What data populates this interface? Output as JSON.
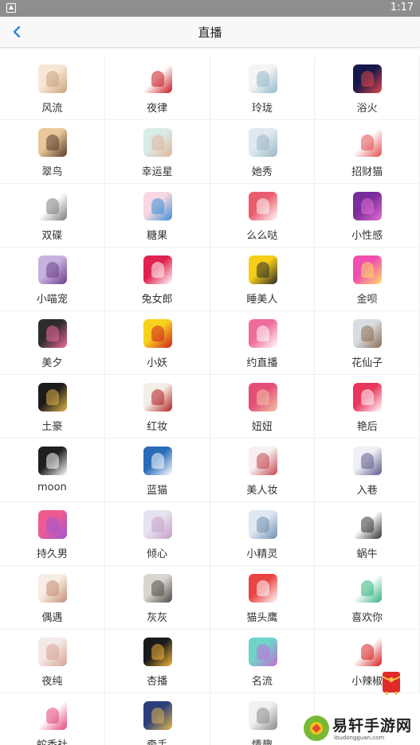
{
  "status_bar": {
    "time": "1:17"
  },
  "nav": {
    "title": "直播"
  },
  "apps": [
    {
      "label": "风流",
      "icon": "anime-girl-icon",
      "c1": "#f6e7d5",
      "c2": "#c9a37b"
    },
    {
      "label": "夜律",
      "icon": "red-calligraphy-icon",
      "c1": "#ffffff",
      "c2": "#c8161d"
    },
    {
      "label": "玲珑",
      "icon": "dancer-icon",
      "c1": "#f4f4f4",
      "c2": "#8fb9c9"
    },
    {
      "label": "浴火",
      "icon": "phoenix-icon",
      "c1": "#16184a",
      "c2": "#e2474b"
    },
    {
      "label": "翠鸟",
      "icon": "girl-photo-icon",
      "c1": "#e9c79a",
      "c2": "#5a3a2a"
    },
    {
      "label": "幸运星",
      "icon": "girl-photo-icon",
      "c1": "#d8ece8",
      "c2": "#e2b59a"
    },
    {
      "label": "她秀",
      "icon": "anime-girl-icon",
      "c1": "#dfe9ef",
      "c2": "#9cb7c6"
    },
    {
      "label": "招财猫",
      "icon": "lucky-cat-icon",
      "c1": "#ffffff",
      "c2": "#e34c4c"
    },
    {
      "label": "双碟",
      "icon": "apple-icon",
      "c1": "#ffffff",
      "c2": "#7b7b7b"
    },
    {
      "label": "糖果",
      "icon": "candy-icon",
      "c1": "#f8d8e2",
      "c2": "#3b8fd8"
    },
    {
      "label": "么么哒",
      "icon": "flower-icon",
      "c1": "#ea5d6f",
      "c2": "#ffffff"
    },
    {
      "label": "小性感",
      "icon": "silhouette-icon",
      "c1": "#7a2d9c",
      "c2": "#e56fd4"
    },
    {
      "label": "小喵宠",
      "icon": "anime-girl-icon",
      "c1": "#c7b2de",
      "c2": "#6b3e8b"
    },
    {
      "label": "兔女郎",
      "icon": "bunny-icon",
      "c1": "#e0234e",
      "c2": "#ffffff"
    },
    {
      "label": "睡美人",
      "icon": "play-icon",
      "c1": "#f6cd17",
      "c2": "#2b2b2b"
    },
    {
      "label": "金呗",
      "icon": "cup-icon",
      "c1": "#f04fae",
      "c2": "#ffe066"
    },
    {
      "label": "美夕",
      "icon": "m-logo-icon",
      "c1": "#2d2d2d",
      "c2": "#f06a9c"
    },
    {
      "label": "小妖",
      "icon": "cartoon-face-icon",
      "c1": "#f7d21d",
      "c2": "#d21f1f"
    },
    {
      "label": "约直播",
      "icon": "yue-logo-icon",
      "c1": "#ee6b9b",
      "c2": "#ffffff"
    },
    {
      "label": "花仙子",
      "icon": "doll-icon",
      "c1": "#d7dde2",
      "c2": "#8b6b52"
    },
    {
      "label": "土豪",
      "icon": "tuhao-logo-icon",
      "c1": "#1b1b1b",
      "c2": "#e2b54b"
    },
    {
      "label": "红妆",
      "icon": "rose-icon",
      "c1": "#f3efe6",
      "c2": "#b21e22"
    },
    {
      "label": "妞妞",
      "icon": "anime-girl-icon",
      "c1": "#e24e78",
      "c2": "#f2c6a6"
    },
    {
      "label": "艳后",
      "icon": "lightning-icon",
      "c1": "#e8365d",
      "c2": "#ffffff"
    },
    {
      "label": "moon",
      "icon": "moon-icon",
      "c1": "#1f1f1f",
      "c2": "#ffffff"
    },
    {
      "label": "蓝猫",
      "icon": "blue-cat-icon",
      "c1": "#2a6bb8",
      "c2": "#ffffff"
    },
    {
      "label": "美人妆",
      "icon": "makeup-icon",
      "c1": "#f7f0f2",
      "c2": "#c2464f"
    },
    {
      "label": "入巷",
      "icon": "anime-girl-icon",
      "c1": "#efeff5",
      "c2": "#5b5b8c"
    },
    {
      "label": "持久男",
      "icon": "heart-icon",
      "c1": "#ee5a8f",
      "c2": "#9d57d8"
    },
    {
      "label": "倾心",
      "icon": "girl-photo-icon",
      "c1": "#e6e2ef",
      "c2": "#c7a0c8"
    },
    {
      "label": "小精灵",
      "icon": "girl-photo-icon",
      "c1": "#dfe8f1",
      "c2": "#6f8fb1"
    },
    {
      "label": "蜗牛",
      "icon": "snail-logo-icon",
      "c1": "#ffffff",
      "c2": "#333333"
    },
    {
      "label": "偶遇",
      "icon": "dancer-icon",
      "c1": "#f7ede6",
      "c2": "#c48e73"
    },
    {
      "label": "灰灰",
      "icon": "girl-photo-icon",
      "c1": "#d9d6cf",
      "c2": "#4f4a45"
    },
    {
      "label": "猫头鹰",
      "icon": "owl-icon",
      "c1": "#e84444",
      "c2": "#ffffff"
    },
    {
      "label": "喜欢你",
      "icon": "cards-icon",
      "c1": "#ffffff",
      "c2": "#35b37e"
    },
    {
      "label": "夜纯",
      "icon": "girl-photo-icon",
      "c1": "#f3e9e6",
      "c2": "#d8a293"
    },
    {
      "label": "杏播",
      "icon": "x-logo-icon",
      "c1": "#1a1a1a",
      "c2": "#f2b739"
    },
    {
      "label": "名流",
      "icon": "gradient-logo-icon",
      "c1": "#6fd3c9",
      "c2": "#c66bd8"
    },
    {
      "label": "小辣椒",
      "icon": "chili-icon",
      "c1": "#ffffff",
      "c2": "#d61f1f"
    },
    {
      "label": "蛇香社",
      "icon": "pink-circle-icon",
      "c1": "#ffffff",
      "c2": "#e2437a"
    },
    {
      "label": "牵手",
      "icon": "couple-icon",
      "c1": "#2d3f7a",
      "c2": "#e6b74f"
    },
    {
      "label": "情趣",
      "icon": "girl-photo-icon",
      "c1": "#f1f1f1",
      "c2": "#8a8a8a"
    }
  ],
  "watermark": {
    "name": "易轩手游网",
    "url": "ibudongguan.com"
  },
  "float_badge": {
    "icon": "red-envelope-icon",
    "color": "#e12b2b"
  }
}
